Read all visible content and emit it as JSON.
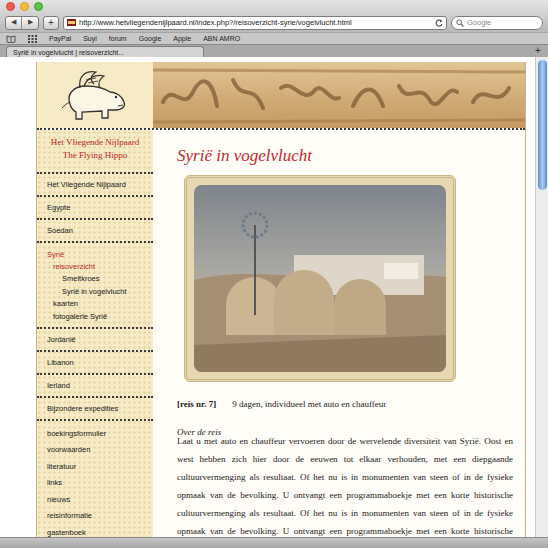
{
  "browser": {
    "nav_buttons": [
      "◀",
      "▶"
    ],
    "new_tab_button": "+",
    "url": "http://www.hetvliegendenijlpaard.nl/index.php?/reisoverzicht-syrie/vogelvlucht.html",
    "search": {
      "placeholder": "Google"
    },
    "bookmarks": [
      "PayPal",
      "Suyi",
      "forum",
      "Google",
      "Apple",
      "ABN AMRO"
    ],
    "tabs": [
      {
        "label": "Syrië in vogelvlucht | reisoverzicht...",
        "selected": true
      }
    ],
    "tab_add_button": "+"
  },
  "site": {
    "title_lines": [
      "Het Vliegende Nijlpaard",
      "The Flying Hippo"
    ]
  },
  "nav": {
    "sections": [
      {
        "kind": "main",
        "items": [
          {
            "label": "Het Vliegende Nijlpaard",
            "depth": 0,
            "selected": false
          }
        ]
      },
      {
        "kind": "main",
        "items": [
          {
            "label": "Egypte",
            "depth": 0,
            "selected": false
          }
        ]
      },
      {
        "kind": "main",
        "items": [
          {
            "label": "Soedan",
            "depth": 0,
            "selected": false
          }
        ]
      },
      {
        "kind": "group",
        "items": [
          {
            "label": "Syrië",
            "depth": 0,
            "selected": true
          },
          {
            "label": "reisoverzicht",
            "depth": 1,
            "selected": true
          },
          {
            "label": "Smeltkroes",
            "depth": 2,
            "selected": false
          },
          {
            "label": "Syrië in vogelvlucht",
            "depth": 2,
            "selected": false
          },
          {
            "label": "kaarten",
            "depth": 1,
            "selected": false
          },
          {
            "label": "fotogalerie Syrië",
            "depth": 1,
            "selected": false
          }
        ]
      },
      {
        "kind": "main",
        "items": [
          {
            "label": "Jordanië",
            "depth": 0,
            "selected": false
          }
        ]
      },
      {
        "kind": "main",
        "items": [
          {
            "label": "Libanon",
            "depth": 0,
            "selected": false
          }
        ]
      },
      {
        "kind": "main",
        "items": [
          {
            "label": "Ierland",
            "depth": 0,
            "selected": false
          }
        ]
      },
      {
        "kind": "main",
        "items": [
          {
            "label": "Bijzondere expedities",
            "depth": 0,
            "selected": false
          }
        ]
      },
      {
        "kind": "utility",
        "items": [
          {
            "label": "boekingsformulier",
            "depth": 0,
            "selected": false
          },
          {
            "label": "voorwaarden",
            "depth": 0,
            "selected": false
          },
          {
            "label": "literatuur",
            "depth": 0,
            "selected": false
          },
          {
            "label": "links",
            "depth": 0,
            "selected": false
          },
          {
            "label": "nieuws",
            "depth": 0,
            "selected": false
          },
          {
            "label": "reisinformatie",
            "depth": 0,
            "selected": false
          },
          {
            "label": "gastenboek",
            "depth": 0,
            "selected": false
          }
        ]
      }
    ]
  },
  "article": {
    "heading": "Syrië in vogelvlucht",
    "trip_number": "[reis nr. 7]",
    "trip_summary": "9 dagen, individueel met auto en chauffeur",
    "section_title": "Over de reis",
    "paragraph_lines": [
      "Laat u met auto en chauffeur vervoeren door de wervelende diversiteit van Syrië. Oost en",
      "west hebben zich hier door de eeuwen tot elkaar verhouden, met een diepgaande",
      "cultuurvermenging als resultaat. Of het nu is in monumenten van steen of in de fysieke",
      "opmaak van de bevolking. U ontvangt een programmaboekje met een korte historische",
      "cultuurvermenging als resultaat. Of het nu is in monumenten van steen of in de fysieke",
      "opmaak van de bevolking. U ontvangt een programmaboekje met een korte historische"
    ]
  }
}
